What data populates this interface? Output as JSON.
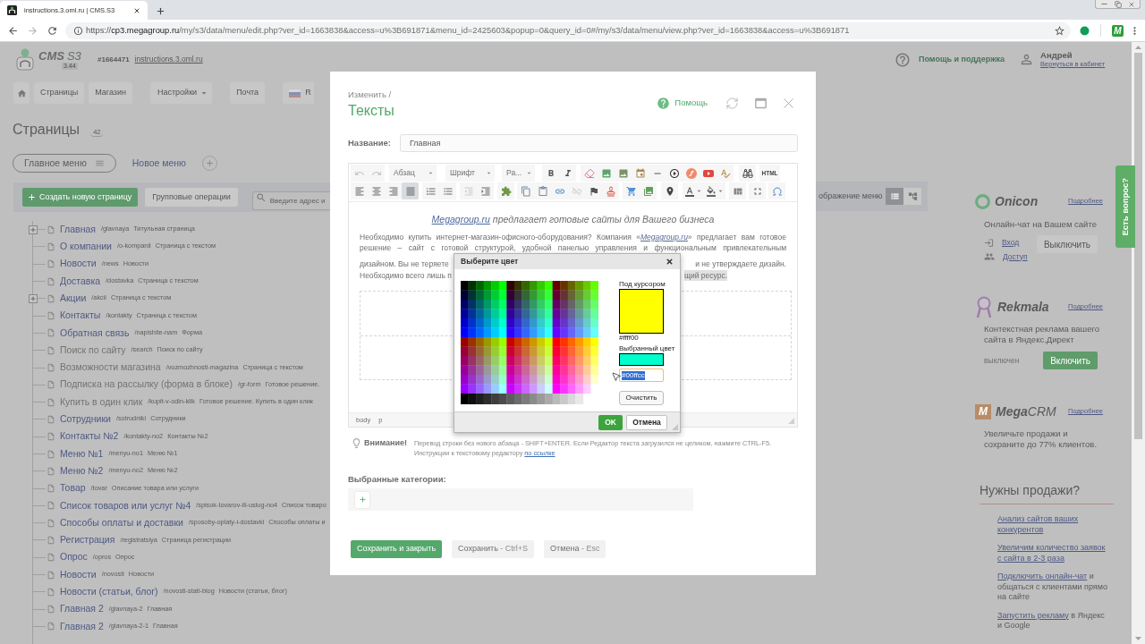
{
  "browser": {
    "tab": {
      "title": "instructions.3.oml.ru | CMS.S3",
      "selected": true
    },
    "url": {
      "scheme": "https://",
      "host": "cp3.megagroup.ru",
      "path": "/my/s3/data/menu/edit.php?ver_id=1663838&access=u%3B691871&menu_id=2425603&popup=0&query_id=0#/my/s3/data/menu/view.php?ver_id=1663838&access=u%3B691871"
    },
    "extension_mark": "M"
  },
  "header": {
    "logo": {
      "text": "CMS",
      "accent": "S3",
      "version": "3.44"
    },
    "site_id": "#1664471",
    "site_link": "instructions.3.oml.ru",
    "help": "Помощь и поддержка",
    "user": {
      "name": "Андрей",
      "link": "Вернуться в кабинет"
    }
  },
  "nav": [
    {
      "items": [
        {
          "kind": "home"
        },
        {
          "kind": "button",
          "label": "Страницы"
        },
        {
          "kind": "button",
          "label": "Магазин"
        }
      ]
    },
    {
      "items": [
        {
          "kind": "dropdown",
          "label": "Настройки"
        }
      ]
    },
    {
      "items": [
        {
          "kind": "button",
          "label": "Почта"
        }
      ]
    },
    {
      "items": [
        {
          "kind": "language",
          "label": "R"
        }
      ]
    }
  ],
  "pages": {
    "title": "Страницы",
    "count": "42",
    "menus": [
      {
        "label": "Главное меню",
        "selected": true
      },
      {
        "label": "Новое меню",
        "selected": false
      }
    ],
    "toolbar": {
      "create": "Создать новую страницу",
      "group_ops": "Групповые операции",
      "search_placeholder": "Введите адрес и",
      "view_label": "ображение меню",
      "views": [
        {
          "kind": "list",
          "selected": true
        },
        {
          "kind": "tree",
          "selected": false
        }
      ]
    },
    "tree": [
      {
        "title": "Главная",
        "slug": "/glavnaya",
        "type": "Титульная страница",
        "hidden": false,
        "collapsed": true
      },
      {
        "title": "О компании",
        "slug": "/o-kompanii",
        "type": "Страница с текстом",
        "hidden": false,
        "collapsed": false
      },
      {
        "title": "Новости",
        "slug": "/news",
        "type": "Новости",
        "hidden": false,
        "collapsed": false
      },
      {
        "title": "Доставка",
        "slug": "/dostavka",
        "type": "Страница с текстом",
        "hidden": false,
        "collapsed": false
      },
      {
        "title": "Акции",
        "slug": "/akcii",
        "type": "Страница с текстом",
        "hidden": false,
        "collapsed": true
      },
      {
        "title": "Контакты",
        "slug": "/kontakty",
        "type": "Страница с текстом",
        "hidden": false,
        "collapsed": false
      },
      {
        "title": "Обратная связь",
        "slug": "/napishite-nam",
        "type": "Форма",
        "hidden": false,
        "collapsed": false
      },
      {
        "title": "Поиск по сайту",
        "slug": "/search",
        "type": "Поиск по сайту",
        "hidden": true,
        "collapsed": false
      },
      {
        "title": "Возможности магазина",
        "slug": "/vozmozhnosti-magazina",
        "type": "Страница с текстом",
        "hidden": true,
        "collapsed": false
      },
      {
        "title": "Подписка на рассылку (форма в блоке)",
        "slug": "/gr-form",
        "type": "Готовое решение.",
        "hidden": true,
        "collapsed": false
      },
      {
        "title": "Купить в один клик",
        "slug": "/kupit-v-odin-klik",
        "type": "Готовое решение. Купить в один клик",
        "hidden": true,
        "collapsed": false
      },
      {
        "title": "Сотрудники",
        "slug": "/sotrudniki",
        "type": "Сотрудники",
        "hidden": false,
        "collapsed": false
      },
      {
        "title": "Контакты №2",
        "slug": "/kontakty-no2",
        "type": "Контакты №2",
        "hidden": false,
        "collapsed": false
      },
      {
        "title": "Меню №1",
        "slug": "/menyu-no1",
        "type": "Меню №1",
        "hidden": false,
        "collapsed": false
      },
      {
        "title": "Меню №2",
        "slug": "/menyu-no2",
        "type": "Меню №2",
        "hidden": false,
        "collapsed": false
      },
      {
        "title": "Товар",
        "slug": "/tovar",
        "type": "Описание товара или услуги",
        "hidden": false,
        "collapsed": false
      },
      {
        "title": "Список товаров или услуг №4",
        "slug": "/spisok-tovarov-ili-uslug-no4",
        "type": "Список товаро",
        "hidden": false,
        "collapsed": false
      },
      {
        "title": "Способы оплаты и доставки",
        "slug": "/sposoby-oplaty-i-dostavki",
        "type": "Способы оплаты и",
        "hidden": false,
        "collapsed": false
      },
      {
        "title": "Регистрация",
        "slug": "/registratsiya",
        "type": "Страница регистрации",
        "hidden": false,
        "collapsed": false
      },
      {
        "title": "Опрос",
        "slug": "/opros",
        "type": "Опрос",
        "hidden": false,
        "collapsed": false
      },
      {
        "title": "Новости",
        "slug": "/novosti",
        "type": "Новости",
        "hidden": false,
        "collapsed": false
      },
      {
        "title": "Новости (статьи, блог)",
        "slug": "/novosti-stati-blog",
        "type": "Новости (статьи, блог)",
        "hidden": false,
        "collapsed": false
      },
      {
        "title": "Главная 2",
        "slug": "/glavnaya-2",
        "type": "Главная",
        "hidden": false,
        "collapsed": false
      },
      {
        "title": "Главная 2",
        "slug": "/glavnaya-2-1",
        "type": "Главная",
        "hidden": false,
        "collapsed": false
      }
    ]
  },
  "sidebar": {
    "widgets": [
      {
        "kind": "onicon",
        "logo": "Onicon",
        "more": "Подробнее",
        "text": "Онлайн-чат на Вашем сайте",
        "links": [
          {
            "kind": "login",
            "label": "Вход"
          },
          {
            "kind": "access",
            "label": "Доступ"
          }
        ],
        "button": {
          "label": "Выключить",
          "primary": false
        }
      },
      {
        "kind": "rekmala",
        "logo": "Rekmala",
        "more": "Подробнее",
        "text": "Контекстная реклама вашего сайта в Яндекс.Директ",
        "status": "выключен",
        "button": {
          "label": "Включить",
          "primary": true
        }
      },
      {
        "kind": "megacrm",
        "logo": "**Mega**CRM",
        "mark": "M",
        "more": "Подробнее",
        "text": "Увеличьте продажи и сохраните до 77% клиентов."
      }
    ],
    "sales": {
      "title": "Нужны продажи?",
      "items": [
        {
          "link": "Анализ сайтов ваших конкурентов"
        },
        {
          "link": "Увеличим количество заявок с сайта в 2-3 раза"
        },
        {
          "link": "Подключить онлайн-чат",
          "text": " и общаться с клиентами прямо на сайте"
        },
        {
          "link": "Запустить рекламу",
          "text": " в Яндекс и Google"
        }
      ]
    },
    "ask_tab": "Есть вопрос?"
  },
  "modal": {
    "breadcrumb": "Изменить /",
    "title": "Тексты",
    "help": "Помощь",
    "name": {
      "label": "Название:",
      "value": "Главная"
    },
    "editor": {
      "history": [
        {
          "kind": "undo",
          "disabled": true
        },
        {
          "kind": "redo",
          "disabled": true
        }
      ],
      "dropdowns": [
        {
          "label": "Абзац"
        },
        {
          "label": "Шрифт"
        },
        {
          "label": "Ра..."
        }
      ],
      "source": "HTML",
      "align": [
        {
          "kind": "left",
          "selected": false
        },
        {
          "kind": "center",
          "selected": false
        },
        {
          "kind": "right",
          "selected": false
        },
        {
          "kind": "justify",
          "selected": true
        }
      ],
      "indent": [
        {
          "kind": "outdent",
          "disabled": true
        },
        {
          "kind": "indent",
          "disabled": false
        }
      ],
      "links": [
        {
          "kind": "link",
          "disabled": false
        },
        {
          "kind": "unlink",
          "disabled": true
        }
      ],
      "heading": {
        "link": "Megagroup.ru",
        "text": " предлагает готовые сайты для Вашего бизнеса"
      },
      "lines": [
        {
          "kind": "full",
          "before": "Необходимо купить интернет-магазин-офисного-оборудования? Компания «",
          "link": "Megagroup.ru",
          "after": "» предлагает вам готовое"
        },
        {
          "kind": "full",
          "before": "решение – сайт с готовой структурой, удобной панелью управления и функциональным привлекательным"
        },
        {
          "kind": "split",
          "left": "дизайном. Вы не теряете",
          "right": "и не утверждаете дизайн.",
          "highlighted": false
        },
        {
          "kind": "split_end",
          "left": "Необходимо всего лишь п",
          "right": "щий ресурс.",
          "highlighted": true
        }
      ],
      "path": [
        "body",
        "p"
      ]
    },
    "color_dialog": {
      "title": "Выберите цвет",
      "swatches": [
        {
          "kind": "preview",
          "label": "Под курсором",
          "color": "#ffff00",
          "hex": "#ffff00"
        },
        {
          "kind": "input",
          "label": "Выбранный цвет",
          "color": "#00ffcc",
          "value": "#00ffcc",
          "highlighted": true
        }
      ],
      "clear": "Очистить",
      "ok": "OK",
      "cancel": "Отмена"
    },
    "notice": {
      "title": "Внимание!",
      "lines": [
        "Перевод строки без нового абзаца - SHIFT+ENTER. Если Редактор текста загрузился не целиком, нажмите CTRL-F5.",
        "Инструкции к текстовому редактору "
      ],
      "link": "по ссылке"
    },
    "categories": {
      "label": "Выбранные категории:"
    },
    "buttons": [
      {
        "kind": "primary",
        "label": "Сохранить и закрыть"
      },
      {
        "kind": "secondary",
        "label": "Сохранить",
        "shortcut": " - Ctrl+S"
      },
      {
        "kind": "secondary",
        "label": "Отмена",
        "shortcut": " - Esc"
      }
    ]
  }
}
